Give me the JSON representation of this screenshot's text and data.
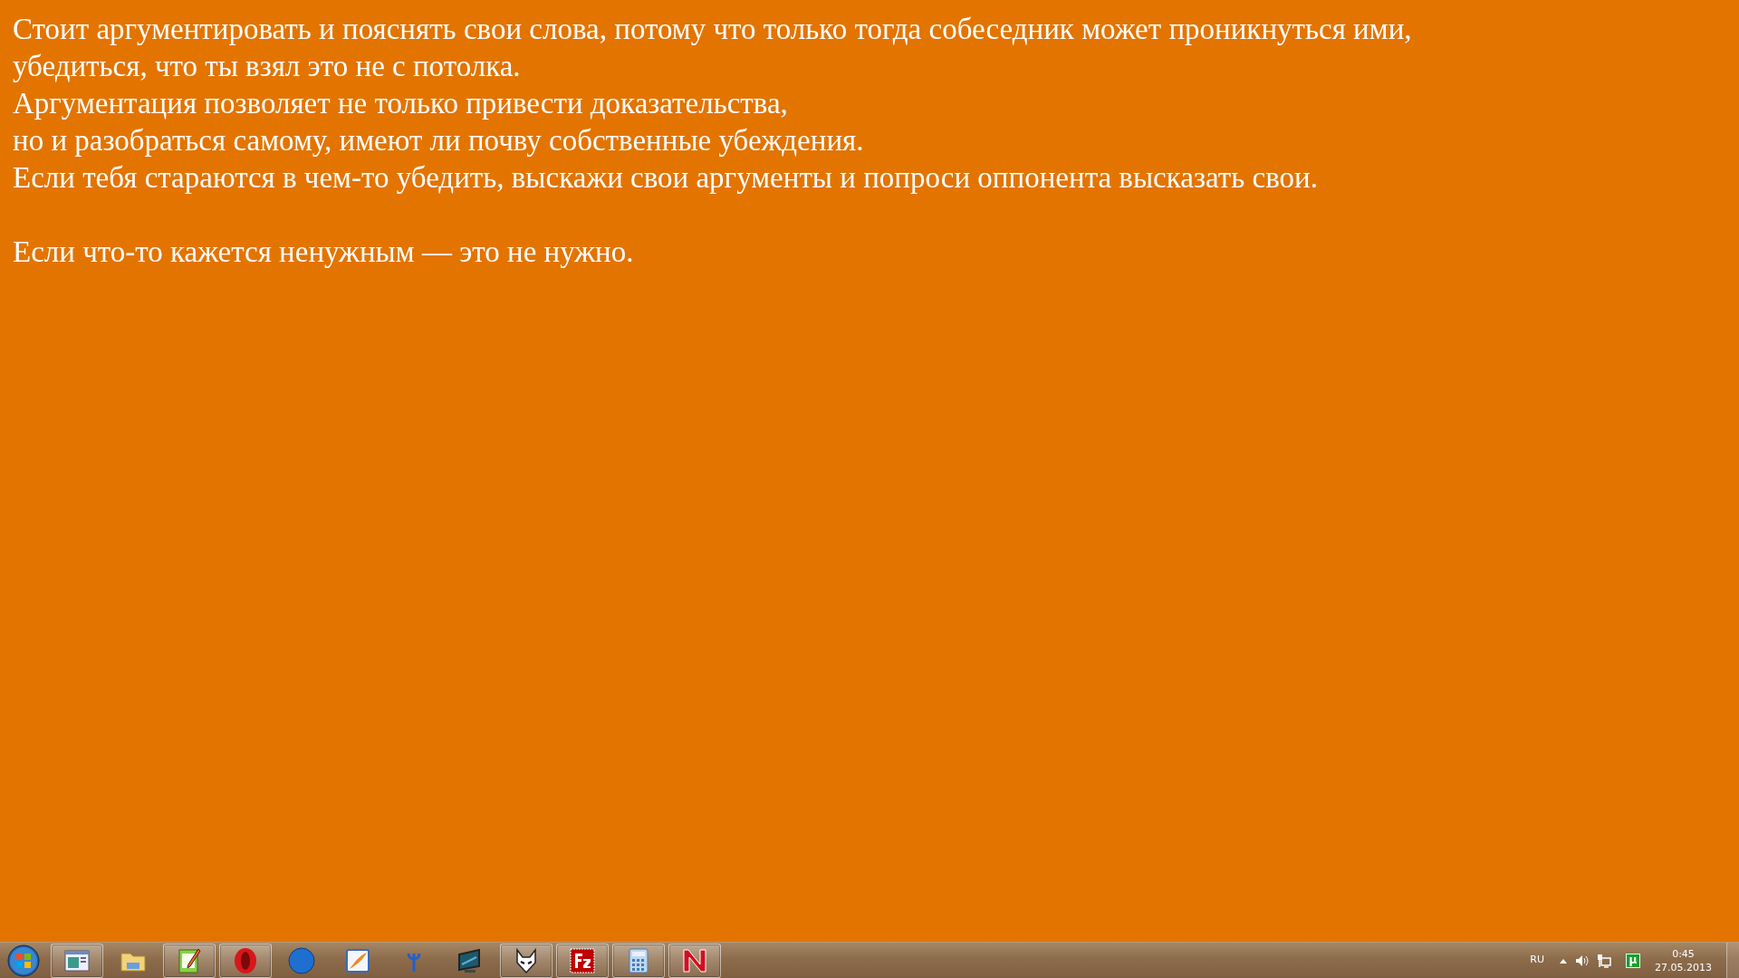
{
  "desktop": {
    "paragraphs": [
      {
        "lines": [
          "Стоит аргументировать и пояснять свои слова, потому что только тогда собеседник может проникнуться ими,",
          "убедиться, что ты взял это не с потолка.",
          "Аргументация позволяет не только привести доказательства,",
          "но и разобраться самому, имеют ли почву собственные убеждения.",
          "Если тебя стараются в чем-то убедить, выскажи свои аргументы и попроси оппонента высказать свои."
        ]
      },
      {
        "lines": [
          "Если что-то кажется ненужным — это не нужно."
        ]
      }
    ]
  },
  "taskbar": {
    "items": [
      {
        "running": true
      },
      {
        "running": false
      },
      {
        "running": true
      },
      {
        "running": true
      },
      {
        "running": false
      },
      {
        "running": false
      },
      {
        "running": false
      },
      {
        "running": false
      },
      {
        "running": true
      },
      {
        "running": true
      },
      {
        "running": true
      },
      {
        "running": true
      }
    ],
    "tray": {
      "language": "RU",
      "torrent_badge": "µ",
      "time": "0:45",
      "date": "27.05.2013"
    }
  }
}
